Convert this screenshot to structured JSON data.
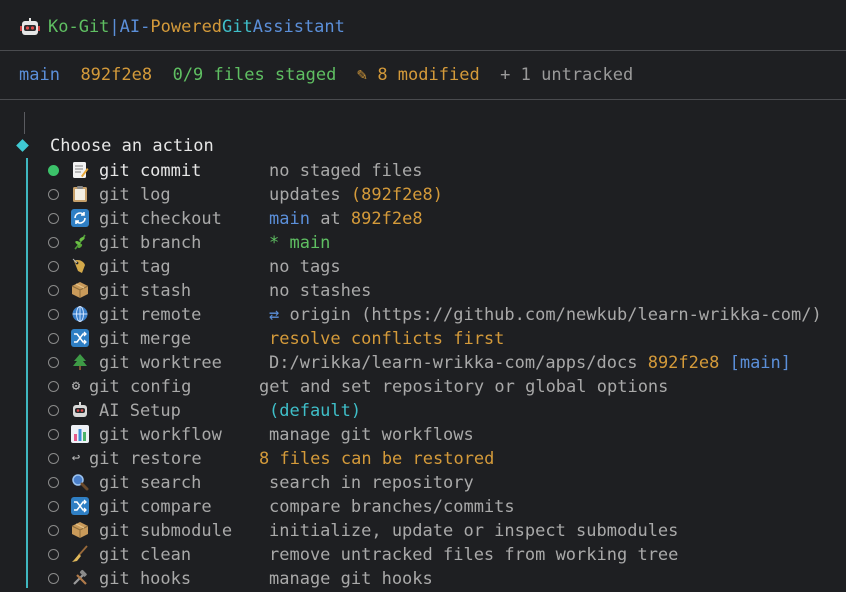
{
  "header": {
    "app": "Ko-Git",
    "pipe": "|",
    "ai": "AI-",
    "powered": "Powered",
    "git": "Git",
    "assistant": "Assistant"
  },
  "status": {
    "branch": "main",
    "commit": "892f2e8",
    "staged": "0/9 files staged",
    "modified_icon": "✎",
    "modified": "8 modified",
    "untracked": "+ 1 untracked"
  },
  "prompt": "Choose an action",
  "actions": [
    {
      "cmd": "git commit",
      "icon": "memo-icon",
      "parts": [
        {
          "t": "no staged files",
          "c": "dim"
        }
      ]
    },
    {
      "cmd": "git log",
      "icon": "clipboard-icon",
      "parts": [
        {
          "t": "updates ",
          "c": "dim"
        },
        {
          "t": "(892f2e8)",
          "c": "orange"
        }
      ]
    },
    {
      "cmd": "git checkout",
      "icon": "arrows-cycle-icon",
      "parts": [
        {
          "t": "main",
          "c": "blue"
        },
        {
          "t": " at ",
          "c": "dim"
        },
        {
          "t": "892f2e8",
          "c": "orange"
        }
      ]
    },
    {
      "cmd": "git branch",
      "icon": "herb-icon",
      "parts": [
        {
          "t": "* main",
          "c": "green"
        }
      ]
    },
    {
      "cmd": "git tag",
      "icon": "tag-icon",
      "parts": [
        {
          "t": "no tags",
          "c": "dim"
        }
      ]
    },
    {
      "cmd": "git stash",
      "icon": "package-icon",
      "parts": [
        {
          "t": "no stashes",
          "c": "dim"
        }
      ]
    },
    {
      "cmd": "git remote",
      "icon": "globe-icon",
      "parts": [
        {
          "t": "⇄ ",
          "c": "blue"
        },
        {
          "t": "origin (https://github.com/newkub/learn-wrikka-com/)",
          "c": "dim"
        }
      ]
    },
    {
      "cmd": "git merge",
      "icon": "shuffle-icon",
      "parts": [
        {
          "t": "resolve conflicts first",
          "c": "orange"
        }
      ]
    },
    {
      "cmd": "git worktree",
      "icon": "tree-icon",
      "parts": [
        {
          "t": "D:/wrikka/learn-wrikka-com/apps/docs ",
          "c": "dim"
        },
        {
          "t": "892f2e8",
          "c": "orange"
        },
        {
          "t": " [main]",
          "c": "blue"
        }
      ]
    },
    {
      "cmd": "git config",
      "icon": "gear-icon",
      "short": true,
      "parts": [
        {
          "t": "get and set repository or global options",
          "c": "dim"
        }
      ]
    },
    {
      "cmd": "AI Setup",
      "icon": "robot-icon",
      "parts": [
        {
          "t": "(default)",
          "c": "teal"
        }
      ]
    },
    {
      "cmd": "git workflow",
      "icon": "bar-chart-icon",
      "parts": [
        {
          "t": "manage git workflows",
          "c": "dim"
        }
      ]
    },
    {
      "cmd": "git restore",
      "icon": "return-arrow-icon",
      "short": true,
      "parts": [
        {
          "t": "8 files can be restored",
          "c": "orange"
        }
      ]
    },
    {
      "cmd": "git search",
      "icon": "magnifier-icon",
      "parts": [
        {
          "t": "search in repository",
          "c": "dim"
        }
      ]
    },
    {
      "cmd": "git compare",
      "icon": "shuffle-icon",
      "parts": [
        {
          "t": "compare branches/commits",
          "c": "dim"
        }
      ]
    },
    {
      "cmd": "git submodule",
      "icon": "package-icon",
      "parts": [
        {
          "t": "initialize, update or inspect submodules",
          "c": "dim"
        }
      ]
    },
    {
      "cmd": "git clean",
      "icon": "broom-icon",
      "parts": [
        {
          "t": "remove untracked files from working tree",
          "c": "dim"
        }
      ]
    },
    {
      "cmd": "git hooks",
      "icon": "hammer-wrench-icon",
      "parts": [
        {
          "t": "manage git hooks",
          "c": "dim"
        }
      ]
    }
  ],
  "colors": {
    "background": "#1e1f22",
    "green": "#5fbf62",
    "orange": "#d49a3a",
    "blue": "#5b8fd9",
    "teal": "#3fbfc9"
  }
}
